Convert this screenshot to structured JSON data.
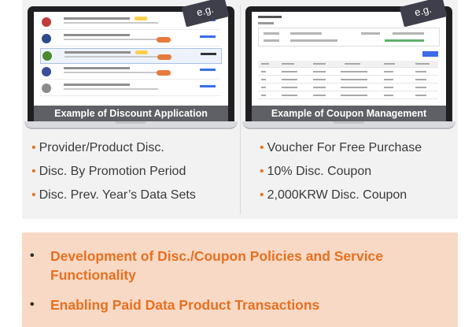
{
  "left_example": {
    "badge": "e.g.",
    "caption": "Example of Discount Application"
  },
  "right_example": {
    "badge": "e.g.",
    "caption": "Example of Coupon Management"
  },
  "left_list": [
    "Provider/Product Disc.",
    "Disc. By Promotion Period",
    "Disc. Prev. Year’s Data Sets"
  ],
  "right_list": [
    "Voucher For Free Purchase",
    "10% Disc. Coupon",
    "2,000KRW Disc. Coupon"
  ],
  "bottom": {
    "items": [
      "Development of Disc./Coupon Policies and Service Functionality",
      "Enabling Paid Data Product Transactions"
    ]
  },
  "colors": {
    "accent_orange": "#e8701f",
    "highlight_bg": "#f7d9c5",
    "caption_bar": "#5f6066",
    "badge_bg": "#3e3f4a"
  }
}
